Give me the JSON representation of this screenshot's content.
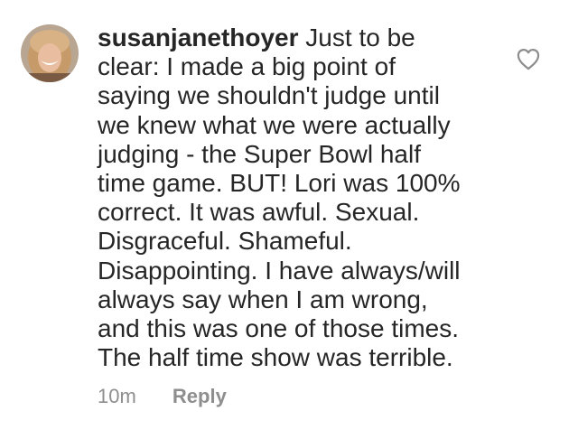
{
  "comment": {
    "username": "susanjanethoyer",
    "text_lines": [
      " Just to be",
      "clear: I made a big point of",
      "saying we shouldn't judge until",
      "we knew what we were actually",
      "judging - the Super Bowl half",
      "time game. BUT! Lori was 100%",
      "correct. It was awful. Sexual.",
      "Disgraceful. Shameful.",
      "Disappointing. I have always/will",
      "always say when I am wrong,",
      "and this was one of those times.",
      "The half time show was terrible."
    ],
    "timestamp": "10m",
    "reply_label": "Reply",
    "like_icon": "heart-outline-icon"
  },
  "colors": {
    "text": "#262626",
    "meta": "#8e8e8e",
    "heart": "#8e8e8e"
  }
}
